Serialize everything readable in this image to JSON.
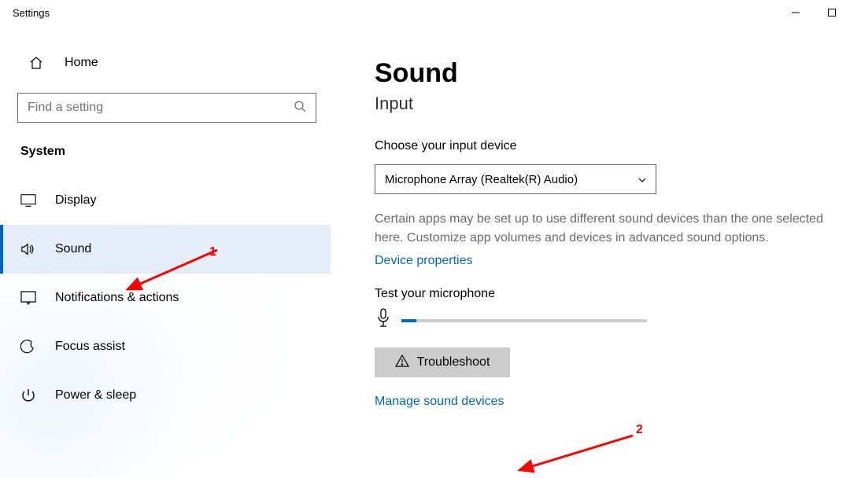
{
  "window": {
    "title": "Settings"
  },
  "sidebar": {
    "home_label": "Home",
    "search_placeholder": "Find a setting",
    "category": "System",
    "items": [
      {
        "label": "Display",
        "icon": "display-icon"
      },
      {
        "label": "Sound",
        "icon": "sound-icon"
      },
      {
        "label": "Notifications & actions",
        "icon": "notifications-icon"
      },
      {
        "label": "Focus assist",
        "icon": "focus-assist-icon"
      },
      {
        "label": "Power & sleep",
        "icon": "power-icon"
      }
    ]
  },
  "content": {
    "page_title": "Sound",
    "section_title": "Input",
    "choose_label": "Choose your input device",
    "dropdown_value": "Microphone Array (Realtek(R) Audio)",
    "description": "Certain apps may be set up to use different sound devices than the one selected here. Customize app volumes and devices in advanced sound options.",
    "device_properties_link": "Device properties",
    "test_label": "Test your microphone",
    "mic_level_percent": 6,
    "troubleshoot_label": "Troubleshoot",
    "manage_link": "Manage sound devices"
  },
  "annotations": {
    "a1_label": "1",
    "a2_label": "2"
  }
}
